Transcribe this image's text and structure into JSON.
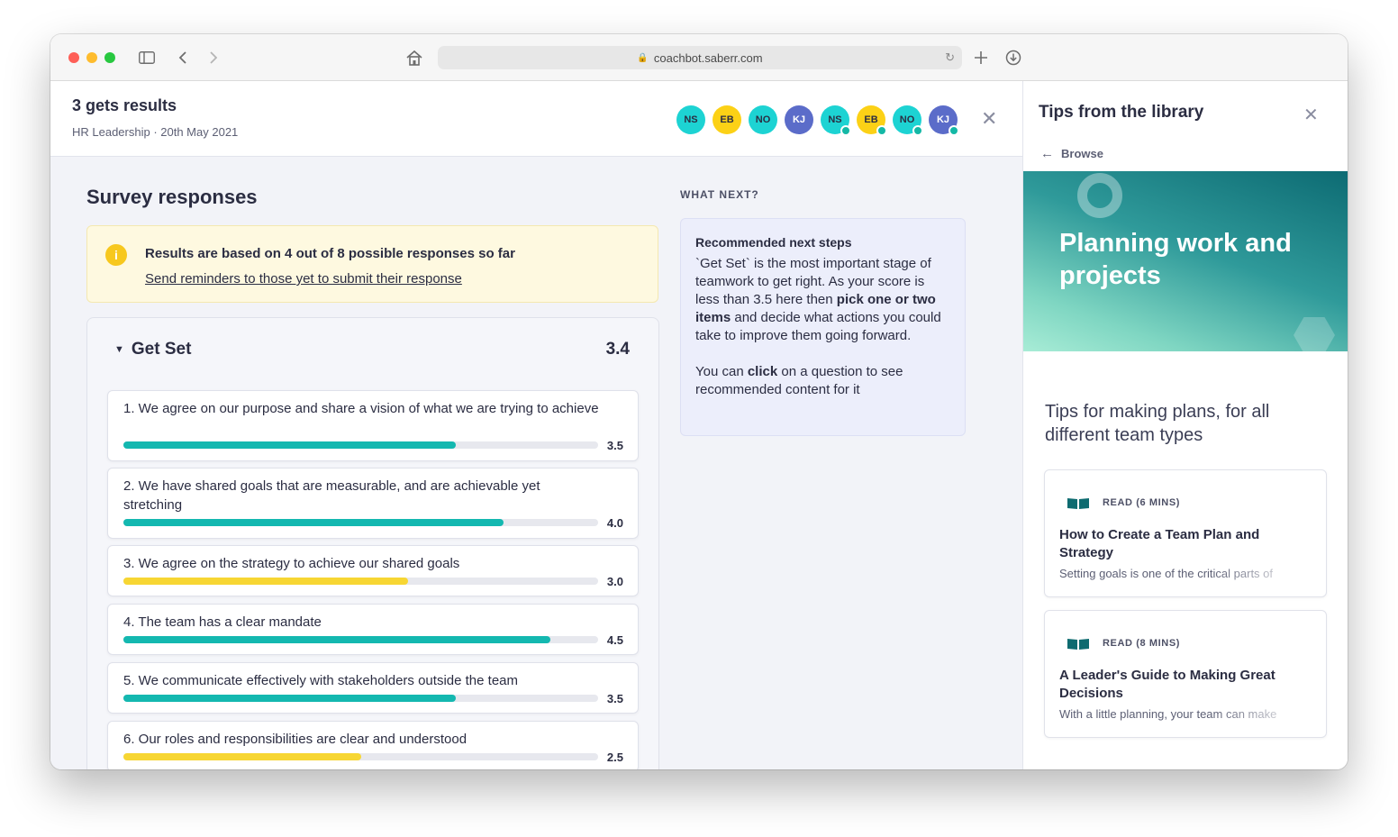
{
  "browser": {
    "url": "coachbot.saberr.com"
  },
  "header": {
    "title": "3 gets results",
    "subtitle": "HR Leadership · 20th May 2021",
    "avatars": [
      {
        "initials": "NS",
        "color": "#1dd3d3",
        "submitted": false
      },
      {
        "initials": "EB",
        "color": "#fcd116",
        "submitted": false
      },
      {
        "initials": "NO",
        "color": "#1dd3d3",
        "submitted": false
      },
      {
        "initials": "KJ",
        "color": "#5b6cc9",
        "submitted": false
      },
      {
        "initials": "NS",
        "color": "#1dd3d3",
        "submitted": true
      },
      {
        "initials": "EB",
        "color": "#fcd116",
        "submitted": true
      },
      {
        "initials": "NO",
        "color": "#1dd3d3",
        "submitted": true
      },
      {
        "initials": "KJ",
        "color": "#5b6cc9",
        "submitted": true
      }
    ]
  },
  "survey": {
    "title": "Survey responses",
    "notice": {
      "text": "Results are based on 4 out of 8 possible responses so far",
      "link": "Send reminders to those yet to submit their response"
    },
    "section": {
      "name": "Get Set",
      "score": "3.4",
      "questions": [
        {
          "text": "1. We agree on our purpose and share a vision of what we are trying to achieve",
          "score": "3.5",
          "value": 3.5,
          "color": "#14b8b0"
        },
        {
          "text": "2. We have shared goals that are measurable, and are achievable yet stretching",
          "score": "4.0",
          "value": 4.0,
          "color": "#14b8b0"
        },
        {
          "text": "3. We agree on the strategy to achieve our shared goals",
          "score": "3.0",
          "value": 3.0,
          "color": "#f7d633"
        },
        {
          "text": "4. The team has a clear mandate",
          "score": "4.5",
          "value": 4.5,
          "color": "#14b8b0"
        },
        {
          "text": "5. We communicate effectively with stakeholders outside the team",
          "score": "3.5",
          "value": 3.5,
          "color": "#14b8b0"
        },
        {
          "text": "6. Our roles and responsibilities are clear and understood",
          "score": "2.5",
          "value": 2.5,
          "color": "#f7d633"
        }
      ]
    }
  },
  "whatnext": {
    "label": "WHAT NEXT?",
    "title": "Recommended next steps",
    "body_a": "`Get Set` is the most important stage of teamwork to get right. As your score is less than 3.5 here then ",
    "body_b": "pick one or two items",
    "body_c": " and decide what actions you could take to improve them going forward.",
    "body2_a": "You can ",
    "body2_b": "click",
    "body2_c": " on a question to see recommended content for it"
  },
  "library": {
    "title": "Tips from the library",
    "browse": "Browse",
    "hero_title": "Planning work and projects",
    "lead": "Tips for making plans, for all different team types",
    "cards": [
      {
        "read": "READ (6 MINS)",
        "title": "How to Create a Team Plan and Strategy",
        "snippet": "Setting goals is one of the critical parts of"
      },
      {
        "read": "READ (8 MINS)",
        "title": "A Leader's Guide to Making Great Decisions",
        "snippet": "With a little planning, your team can make"
      }
    ]
  }
}
